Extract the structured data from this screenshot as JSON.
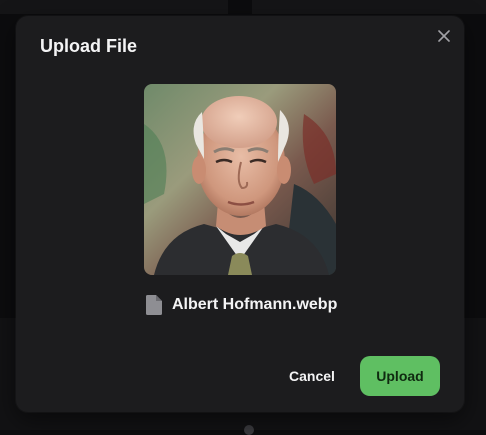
{
  "dialog": {
    "title": "Upload File",
    "close_icon": "close-icon",
    "file": {
      "icon": "file-icon",
      "name": "Albert Hofmann.webp"
    },
    "cancel_label": "Cancel",
    "upload_label": "Upload"
  },
  "colors": {
    "dialog_background": "#1c1c1e",
    "page_background": "#0c0c0e",
    "primary_button": "#5fbf62",
    "text": "#f4f4f5",
    "icon_muted": "#8e8e93"
  }
}
